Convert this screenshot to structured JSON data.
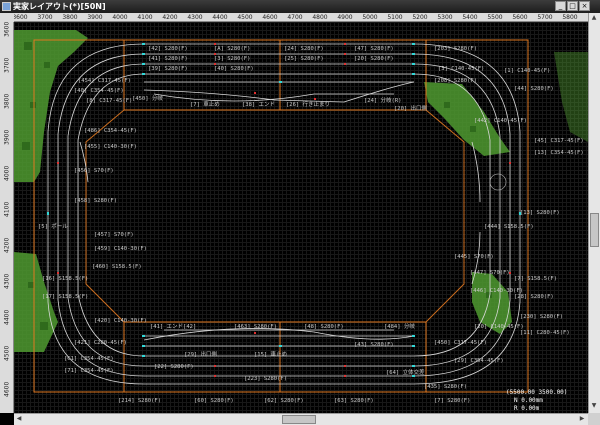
{
  "window": {
    "title": "実家レイアウト(*)[50N]",
    "min_glyph": "_",
    "max_glyph": "□",
    "close_glyph": "×"
  },
  "ruler_top": [
    "3600",
    "3700",
    "3800",
    "3900",
    "4000",
    "4100",
    "4200",
    "4300",
    "4400",
    "4500",
    "4600",
    "4700",
    "4800",
    "4900",
    "5000",
    "5100",
    "5200",
    "5300",
    "5400",
    "5500",
    "5600",
    "5700",
    "5800"
  ],
  "ruler_left": [
    "3600",
    "3700",
    "3800",
    "3900",
    "4000",
    "4100",
    "4200",
    "4300",
    "4400",
    "4500",
    "4600"
  ],
  "colors": {
    "track": "#d8d8d8",
    "frame": "#e07820",
    "grass": "#4f9a30",
    "joint_cyan": "#30d8d8",
    "joint_red": "#e03030"
  },
  "labels": {
    "l1": "[42] S280(F)",
    "l2": "[41] S280(F)",
    "l3": "[A] S280(F)",
    "l4": "[3] S280(F)",
    "l5": "[24] S280(F)",
    "l6": "[25] S280(F)",
    "l7": "[47] S280(F)",
    "l8": "[20] S280(F)",
    "l9": "[203] S280(F)",
    "l10": "[39] S280(F)",
    "l11": "[1] C140-45(F)",
    "l12": "[3] C140-45(F)",
    "l13": "[40] S280(F)",
    "l14": "[38] エンド",
    "l15": "[26] 行き止まり",
    "l16": "[24] 分岐(R)",
    "l17": "[20] 出口側",
    "l18": "[450] 分岐",
    "l19": "[7] 車止め",
    "l20": "[454] C317-45(F)",
    "l21": "[40] C354-45(F)",
    "l22": "[8] C317-45(F)",
    "l23": "[486] C354-45(F)",
    "l24": "[455] C140-30(F)",
    "l25": "[456] S70(F)",
    "l26": "[458] S280(F)",
    "l27": "[5] ポール",
    "l28": "[457] S70(F)",
    "l29": "[459] C140-30(F)",
    "l30": "[460] S158.5(F)",
    "l31": "[16] S158.5(F)",
    "l32": "[17] S158.5(F)",
    "l33": "[420] C140-30(F)",
    "l34": "[421] C280-45(F)",
    "l35": "[61] C354-45(F)",
    "l36": "[71] C354-45(F)",
    "l37": "[214] S280(F)",
    "l38": "[60] S280(F)",
    "l39": "[62] S280(F)",
    "l40": "[63] S280(F)",
    "l41": "[7] S280(F)",
    "l42": "[41] エンド[42]",
    "l43": "[463] S280(F)",
    "l44": "[48] S280(F)",
    "l45": "[43] S280(F)",
    "l46": "[484] 分岐",
    "l47": "[15] 車止め",
    "l48": "[29] 出口側",
    "l49": "[22] S280(F)",
    "l50": "[223] S280(F)",
    "l51": "[450] C317-45(F)",
    "l52": "[29] C354-45(F)",
    "l53": "[442] C140-45(F)",
    "l54": "[44] S280(F)",
    "l55": "[45] C317-45(F)",
    "l56": "[13] C354-45(F)",
    "l57": "[444] S158.5(F)",
    "l58": "[445] S70(F)",
    "l59": "[447] S70(F)",
    "l60": "[446] C140-30(F)",
    "l61": "[7] S158.5(F)",
    "l62": "[28] S280(F)",
    "l63": "[230] S280(F)",
    "l64": "[13] S280(F)",
    "l65": "[208] S280(F)",
    "l66": "[20] C140-45(F)",
    "l67": "[435] S280(F)",
    "l68": "[64] 立体交差",
    "l69": "[11] C280-45(F)"
  },
  "status": {
    "coords": "(5500.00 3500.00)",
    "length": "N 0.00mm",
    "radius": "R 0.00m"
  }
}
